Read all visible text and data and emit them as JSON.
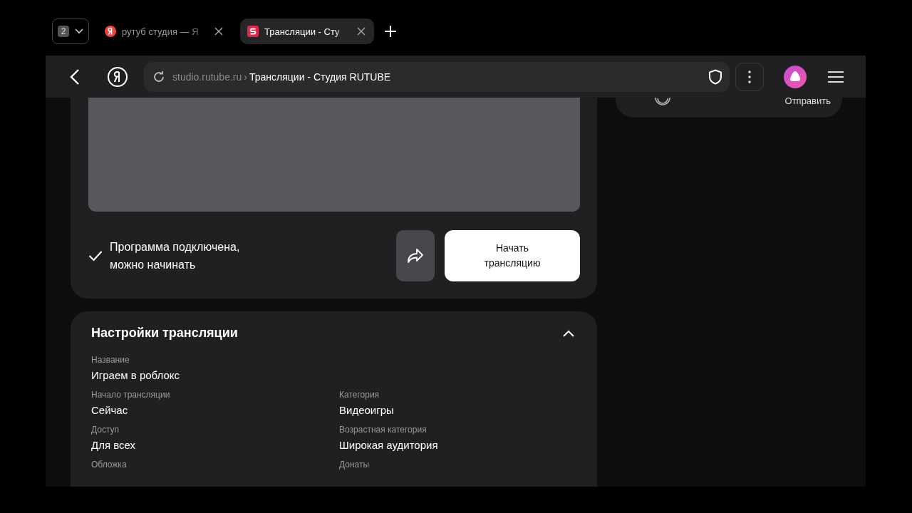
{
  "tab_counter": "2",
  "tabs": [
    {
      "title": "рутуб студия — Я",
      "selected": false
    },
    {
      "title": "Трансляции - Сту",
      "selected": true
    }
  ],
  "address": {
    "domain": "studio.rutube.ru",
    "separator": "›",
    "page_title": "Трансляции - Студия RUTUBE"
  },
  "side_card": {
    "button": "Отправить"
  },
  "stream": {
    "status": "Программа подключена, можно начинать",
    "connected": true,
    "start_button": "Начать трансляцию"
  },
  "settings": {
    "title": "Настройки трансляции",
    "expanded": true,
    "name_field": {
      "label": "Название",
      "value": "Играем в роблокс"
    },
    "fields": [
      {
        "label": "Начало трансляции",
        "value": "Сейчас"
      },
      {
        "label": "Категория",
        "value": "Видеоигры"
      },
      {
        "label": "Доступ",
        "value": "Для всех"
      },
      {
        "label": "Возрастная категория",
        "value": "Широкая аудитория"
      },
      {
        "label": "Обложка"
      },
      {
        "label": "Донаты"
      }
    ]
  }
}
